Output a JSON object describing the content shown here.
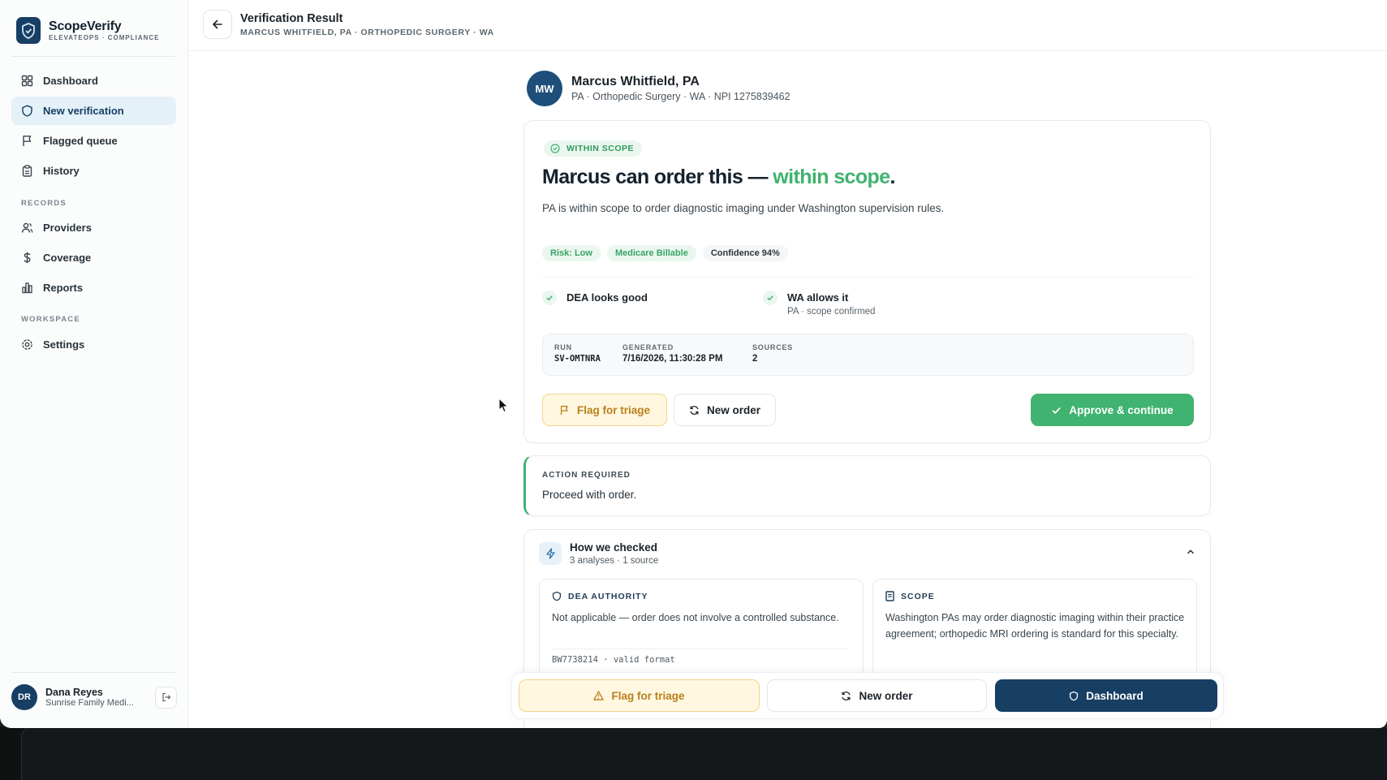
{
  "sidebar": {
    "brand_name": "ScopeVerify",
    "brand_sub": "ELEVATEOPS · COMPLIANCE",
    "nav": [
      {
        "label": "Dashboard",
        "icon": "grid-icon"
      },
      {
        "label": "New verification",
        "icon": "shield-icon",
        "active": true
      },
      {
        "label": "Flagged queue",
        "icon": "flag-icon"
      },
      {
        "label": "History",
        "icon": "clipboard-icon"
      }
    ],
    "records_label": "RECORDS",
    "records": [
      {
        "label": "Providers",
        "icon": "users-icon"
      },
      {
        "label": "Coverage",
        "icon": "dollar-icon"
      },
      {
        "label": "Reports",
        "icon": "bar-chart-icon"
      }
    ],
    "workspace_label": "WORKSPACE",
    "workspace": [
      {
        "label": "Settings",
        "icon": "gear-icon"
      }
    ],
    "user": {
      "initials": "DR",
      "name": "Dana Reyes",
      "org": "Sunrise Family Medi..."
    }
  },
  "header": {
    "title": "Verification Result",
    "subtitle": "MARCUS WHITFIELD, PA · ORTHOPEDIC SURGERY · WA"
  },
  "provider": {
    "initials": "MW",
    "name": "Marcus Whitfield, PA",
    "meta": "PA · Orthopedic Surgery · WA · NPI 1275839462"
  },
  "result": {
    "badge": "WITHIN SCOPE",
    "title_prefix": "Marcus can order this — ",
    "title_highlight": "within scope",
    "title_suffix": ".",
    "description": "PA is within scope to order diagnostic imaging under Washington supervision rules.",
    "pills": {
      "risk": "Risk: Low",
      "billable": "Medicare Billable",
      "confidence": "Confidence 94%"
    },
    "checks": [
      {
        "title": "DEA looks good",
        "sub": ""
      },
      {
        "title": "WA allows it",
        "sub": "PA · scope confirmed"
      }
    ],
    "meta": {
      "run_label": "RUN",
      "run_value": "SV-OMTNRA",
      "generated_label": "GENERATED",
      "generated_value": "7/16/2026, 11:30:28 PM",
      "sources_label": "SOURCES",
      "sources_value": "2"
    },
    "buttons": {
      "flag": "Flag for triage",
      "new_order": "New order",
      "approve": "Approve & continue"
    }
  },
  "action": {
    "label": "ACTION REQUIRED",
    "text": "Proceed with order."
  },
  "how": {
    "title": "How we checked",
    "sub": "3 analyses · 1 source",
    "dea": {
      "label": "DEA AUTHORITY",
      "body": "Not applicable — order does not involve a controlled substance.",
      "foot": "BW7738214 · valid format"
    },
    "scope": {
      "label": "SCOPE",
      "body": "Washington PAs may order diagnostic imaging within their practice agreement; orthopedic MRI ordering is standard for this specialty."
    }
  },
  "bottom_bar": {
    "flag": "Flag for triage",
    "new_order": "New order",
    "dashboard": "Dashboard"
  },
  "colors": {
    "brand": "#173e63",
    "success": "#3fb36f",
    "warning": "#b9801c"
  }
}
